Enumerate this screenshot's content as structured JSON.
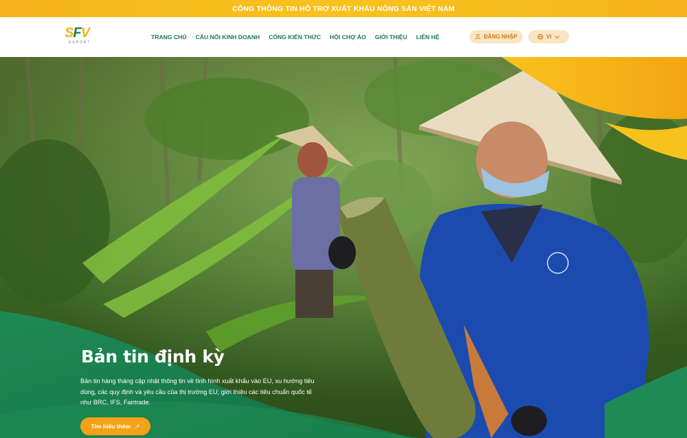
{
  "topbar": {
    "text": "CỔNG THÔNG TIN HỖ TRỢ XUẤT KHẨU NÔNG SẢN VIỆT NAM"
  },
  "logo": {
    "mark_s": "S",
    "mark_f": "F",
    "mark_v": "V",
    "sub": "EXPORT"
  },
  "nav": {
    "items": [
      {
        "label": "TRANG CHỦ"
      },
      {
        "label": "CẦU NỐI KINH DOANH"
      },
      {
        "label": "CỔNG KIẾN THỨC"
      },
      {
        "label": "HỘI CHỢ ẢO"
      },
      {
        "label": "GIỚI THIỆU"
      },
      {
        "label": "LIÊN HỆ"
      }
    ]
  },
  "header_actions": {
    "login_label": "ĐĂNG NHẬP",
    "lang_label": "VI"
  },
  "hero": {
    "title": "Bản tin định kỳ",
    "description": "Bản tin hàng tháng cập nhật thông tin về tình hình xuất khẩu vào EU, xu hướng tiêu dùng, các quy định và yêu cầu của thị trường EU; giới thiệu các tiêu chuẩn quốc tế như BRC, IFS, Fairtrade.",
    "cta_label": "Tìm hiểu thêm",
    "cta_arrow": "↗"
  },
  "colors": {
    "brand_green": "#1f7a47",
    "brand_yellow": "#f5b41a",
    "cta_orange": "#f4a318"
  }
}
